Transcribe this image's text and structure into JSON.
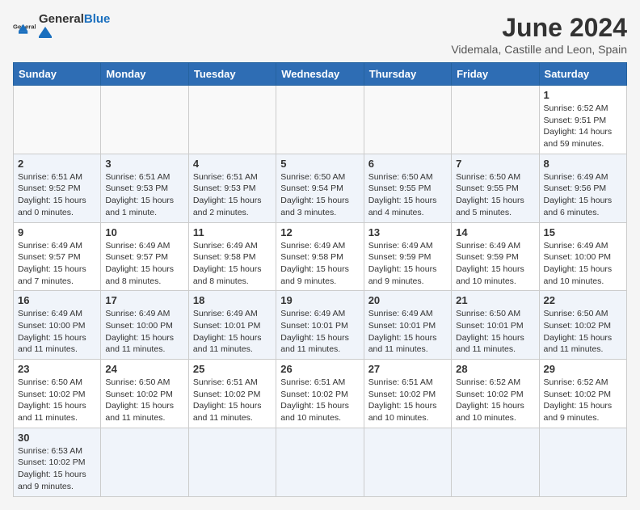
{
  "header": {
    "logo_general": "General",
    "logo_blue": "Blue",
    "month_title": "June 2024",
    "subtitle": "Videmala, Castille and Leon, Spain"
  },
  "weekdays": [
    "Sunday",
    "Monday",
    "Tuesday",
    "Wednesday",
    "Thursday",
    "Friday",
    "Saturday"
  ],
  "weeks": [
    [
      {
        "day": "",
        "info": ""
      },
      {
        "day": "",
        "info": ""
      },
      {
        "day": "",
        "info": ""
      },
      {
        "day": "",
        "info": ""
      },
      {
        "day": "",
        "info": ""
      },
      {
        "day": "",
        "info": ""
      },
      {
        "day": "1",
        "info": "Sunrise: 6:52 AM\nSunset: 9:51 PM\nDaylight: 14 hours\nand 59 minutes."
      }
    ],
    [
      {
        "day": "2",
        "info": "Sunrise: 6:51 AM\nSunset: 9:52 PM\nDaylight: 15 hours\nand 0 minutes."
      },
      {
        "day": "3",
        "info": "Sunrise: 6:51 AM\nSunset: 9:53 PM\nDaylight: 15 hours\nand 1 minute."
      },
      {
        "day": "4",
        "info": "Sunrise: 6:51 AM\nSunset: 9:53 PM\nDaylight: 15 hours\nand 2 minutes."
      },
      {
        "day": "5",
        "info": "Sunrise: 6:50 AM\nSunset: 9:54 PM\nDaylight: 15 hours\nand 3 minutes."
      },
      {
        "day": "6",
        "info": "Sunrise: 6:50 AM\nSunset: 9:55 PM\nDaylight: 15 hours\nand 4 minutes."
      },
      {
        "day": "7",
        "info": "Sunrise: 6:50 AM\nSunset: 9:55 PM\nDaylight: 15 hours\nand 5 minutes."
      },
      {
        "day": "8",
        "info": "Sunrise: 6:49 AM\nSunset: 9:56 PM\nDaylight: 15 hours\nand 6 minutes."
      }
    ],
    [
      {
        "day": "9",
        "info": "Sunrise: 6:49 AM\nSunset: 9:57 PM\nDaylight: 15 hours\nand 7 minutes."
      },
      {
        "day": "10",
        "info": "Sunrise: 6:49 AM\nSunset: 9:57 PM\nDaylight: 15 hours\nand 8 minutes."
      },
      {
        "day": "11",
        "info": "Sunrise: 6:49 AM\nSunset: 9:58 PM\nDaylight: 15 hours\nand 8 minutes."
      },
      {
        "day": "12",
        "info": "Sunrise: 6:49 AM\nSunset: 9:58 PM\nDaylight: 15 hours\nand 9 minutes."
      },
      {
        "day": "13",
        "info": "Sunrise: 6:49 AM\nSunset: 9:59 PM\nDaylight: 15 hours\nand 9 minutes."
      },
      {
        "day": "14",
        "info": "Sunrise: 6:49 AM\nSunset: 9:59 PM\nDaylight: 15 hours\nand 10 minutes."
      },
      {
        "day": "15",
        "info": "Sunrise: 6:49 AM\nSunset: 10:00 PM\nDaylight: 15 hours\nand 10 minutes."
      }
    ],
    [
      {
        "day": "16",
        "info": "Sunrise: 6:49 AM\nSunset: 10:00 PM\nDaylight: 15 hours\nand 11 minutes."
      },
      {
        "day": "17",
        "info": "Sunrise: 6:49 AM\nSunset: 10:00 PM\nDaylight: 15 hours\nand 11 minutes."
      },
      {
        "day": "18",
        "info": "Sunrise: 6:49 AM\nSunset: 10:01 PM\nDaylight: 15 hours\nand 11 minutes."
      },
      {
        "day": "19",
        "info": "Sunrise: 6:49 AM\nSunset: 10:01 PM\nDaylight: 15 hours\nand 11 minutes."
      },
      {
        "day": "20",
        "info": "Sunrise: 6:49 AM\nSunset: 10:01 PM\nDaylight: 15 hours\nand 11 minutes."
      },
      {
        "day": "21",
        "info": "Sunrise: 6:50 AM\nSunset: 10:01 PM\nDaylight: 15 hours\nand 11 minutes."
      },
      {
        "day": "22",
        "info": "Sunrise: 6:50 AM\nSunset: 10:02 PM\nDaylight: 15 hours\nand 11 minutes."
      }
    ],
    [
      {
        "day": "23",
        "info": "Sunrise: 6:50 AM\nSunset: 10:02 PM\nDaylight: 15 hours\nand 11 minutes."
      },
      {
        "day": "24",
        "info": "Sunrise: 6:50 AM\nSunset: 10:02 PM\nDaylight: 15 hours\nand 11 minutes."
      },
      {
        "day": "25",
        "info": "Sunrise: 6:51 AM\nSunset: 10:02 PM\nDaylight: 15 hours\nand 11 minutes."
      },
      {
        "day": "26",
        "info": "Sunrise: 6:51 AM\nSunset: 10:02 PM\nDaylight: 15 hours\nand 10 minutes."
      },
      {
        "day": "27",
        "info": "Sunrise: 6:51 AM\nSunset: 10:02 PM\nDaylight: 15 hours\nand 10 minutes."
      },
      {
        "day": "28",
        "info": "Sunrise: 6:52 AM\nSunset: 10:02 PM\nDaylight: 15 hours\nand 10 minutes."
      },
      {
        "day": "29",
        "info": "Sunrise: 6:52 AM\nSunset: 10:02 PM\nDaylight: 15 hours\nand 9 minutes."
      }
    ],
    [
      {
        "day": "30",
        "info": "Sunrise: 6:53 AM\nSunset: 10:02 PM\nDaylight: 15 hours\nand 9 minutes."
      },
      {
        "day": "",
        "info": ""
      },
      {
        "day": "",
        "info": ""
      },
      {
        "day": "",
        "info": ""
      },
      {
        "day": "",
        "info": ""
      },
      {
        "day": "",
        "info": ""
      },
      {
        "day": "",
        "info": ""
      }
    ]
  ]
}
